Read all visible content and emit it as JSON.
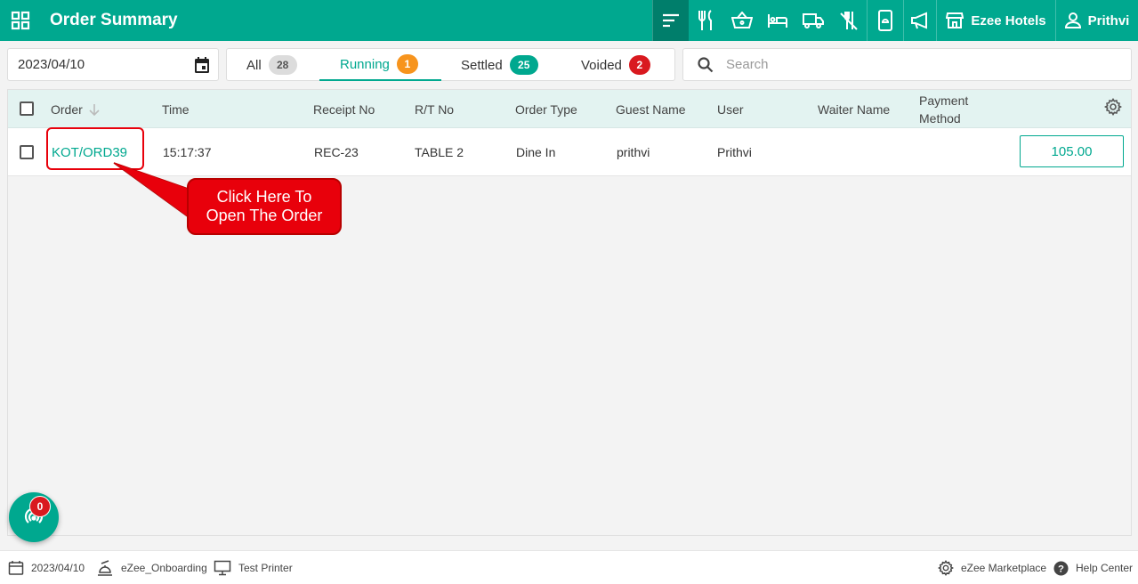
{
  "header": {
    "title": "Order Summary",
    "hotel_label": "Ezee Hotels",
    "user_label": "Prithvi"
  },
  "filters": {
    "date": "2023/04/10",
    "tabs": [
      {
        "label": "All",
        "count": "28"
      },
      {
        "label": "Running",
        "count": "1"
      },
      {
        "label": "Settled",
        "count": "25"
      },
      {
        "label": "Voided",
        "count": "2"
      }
    ],
    "active_tab": "Running",
    "search_placeholder": "Search"
  },
  "table": {
    "columns": {
      "order": "Order",
      "time": "Time",
      "receipt": "Receipt No",
      "rt": "R/T No",
      "type": "Order Type",
      "guest": "Guest Name",
      "user": "User",
      "waiter": "Waiter Name",
      "payment_line1": "Payment",
      "payment_line2": "Method"
    },
    "rows": [
      {
        "order": "KOT/ORD39",
        "time": "15:17:37",
        "receipt": "REC-23",
        "rt": "TABLE 2",
        "type": "Dine In",
        "guest": "prithvi",
        "user": "Prithvi",
        "waiter": "",
        "payment": "",
        "amount": "105.00"
      }
    ]
  },
  "callout": {
    "line1": "Click Here To",
    "line2": "Open The Order"
  },
  "fab": {
    "badge": "0"
  },
  "footer": {
    "date": "2023/04/10",
    "outlet": "eZee_Onboarding",
    "printer": "Test Printer",
    "marketplace": "eZee Marketplace",
    "help": "Help Center"
  },
  "colors": {
    "brand": "#00a88f",
    "brand_dark": "#007e6b",
    "running_badge": "#f7941d",
    "voided_badge": "#d9191f",
    "callout": "#e8000b"
  }
}
